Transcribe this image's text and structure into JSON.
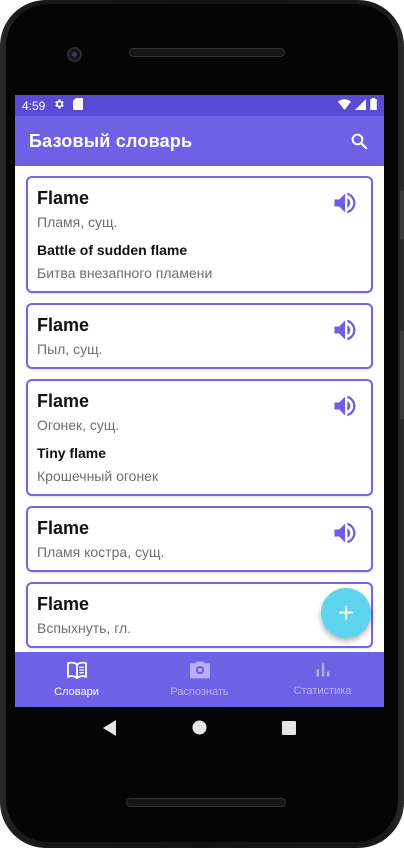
{
  "status_bar": {
    "time": "4:59"
  },
  "app_bar": {
    "title": "Базовый словарь"
  },
  "cards": [
    {
      "word": "Flame",
      "translation": "Пламя, сущ.",
      "example": "Battle of sudden flame",
      "example_translation": "Битва внезапного пламени"
    },
    {
      "word": "Flame",
      "translation": "Пыл, сущ."
    },
    {
      "word": "Flame",
      "translation": "Огонек, сущ.",
      "example": "Tiny flame",
      "example_translation": "Крошечный огонек"
    },
    {
      "word": "Flame",
      "translation": "Пламя костра, сущ."
    },
    {
      "word": "Flame",
      "translation": "Вспыхнуть, гл."
    }
  ],
  "fab": {
    "label": "+"
  },
  "bottom_nav": [
    {
      "label": "Словари",
      "icon": "book-icon",
      "active": true
    },
    {
      "label": "Распознать",
      "icon": "camera-icon",
      "active": false
    },
    {
      "label": "Статистика",
      "icon": "bar-chart-icon",
      "active": false
    }
  ],
  "colors": {
    "primary": "#6e61e6",
    "status_bar": "#5a4bd6",
    "accent": "#5ed3ee",
    "card_border": "#7466e3"
  }
}
